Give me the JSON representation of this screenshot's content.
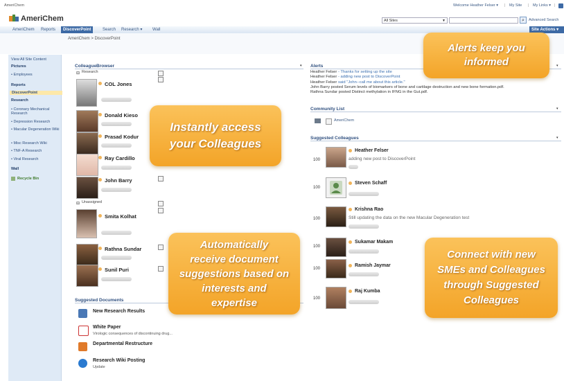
{
  "site": {
    "name": "AmeriChem",
    "top_label": "AmeriChem"
  },
  "topbar": {
    "welcome": "Welcome Heather Felser ▾",
    "my_site": "My Site",
    "my_links": "My Links ▾",
    "sep": "|"
  },
  "search": {
    "scope": "All Sites",
    "advanced": "Advanced Search",
    "actions": "Site Actions ▾"
  },
  "nav": {
    "tabs": [
      "AmeriChem",
      "Reports",
      "DiscoverPoint",
      "Search",
      "Research ▾",
      "Wall"
    ]
  },
  "breadcrumb": "AmeriChem > DiscoverPoint",
  "sidebar": {
    "view_all": "View All Site Content",
    "pictures": "Pictures",
    "employees": "• Employees",
    "reports": "Reports",
    "discoverpoint": "DiscoverPoint",
    "research": "Research",
    "research_items": [
      "• Coronary Mechanical Research",
      "• Depression Research",
      "• Macular Degeneration Wiki",
      "• Misc Research Wiki",
      "• TNF-A Research",
      "• Viral Research"
    ],
    "wall": "Wall",
    "recycle": "Recycle Bin"
  },
  "colleague_browser": {
    "title": "ColleagueBrowser",
    "group_research": "Research",
    "group_unassigned": "Unassigned",
    "research": [
      "COL Jones",
      "Donald Kieso",
      "Prasad Kodur",
      "Ray Cardillo",
      "John Barry"
    ],
    "unassigned": [
      "Smita Kolhat",
      "Rathna Sundar",
      "Sunil Puri"
    ]
  },
  "alerts": {
    "title": "Alerts",
    "lines": [
      {
        "who": "Heather Felser",
        "what": " - Thanks for setting up the site"
      },
      {
        "who": "Heather Felser",
        "what": " - adding new post to DiscoverPoint"
      },
      {
        "who": "Heather Felser",
        "what": " said \"John--call me about this article.\""
      },
      {
        "who": "John Barry",
        "what": " posted Serum levels of biomarkers of bone and cartilage destruction and new bone formation.pdf."
      },
      {
        "who": "Rathna Sundar",
        "what": " posted Distinct methylation in IFNG in the Gut.pdf."
      }
    ]
  },
  "community": {
    "title": "Community List",
    "item": "AmeriChem"
  },
  "suggested_colleagues": {
    "title": "Suggested Colleagues",
    "items": [
      {
        "score": "100",
        "name": "Heather Felser",
        "note": "adding new post to DiscoverPoint"
      },
      {
        "score": "100",
        "name": "Steven Schaff",
        "note": ""
      },
      {
        "score": "100",
        "name": "Krishna Rao",
        "note": "Still updating the data on the new Macular Degeneration test"
      },
      {
        "score": "100",
        "name": "Sukamar Makam",
        "note": ""
      },
      {
        "score": "100",
        "name": "Ramish Jaymar",
        "note": ""
      },
      {
        "score": "100",
        "name": "Raj Kumba",
        "note": ""
      }
    ]
  },
  "suggested_documents": {
    "title": "Suggested Documents",
    "items": [
      {
        "title": "New Research Results",
        "sub": ""
      },
      {
        "title": "White Paper",
        "sub": "Virologic consequences of discontinuing drug..."
      },
      {
        "title": "Departmental Restructure",
        "sub": ""
      },
      {
        "title": "Research Wiki Posting",
        "sub": "Update"
      }
    ]
  },
  "callouts": {
    "alerts": [
      "Alerts keep you",
      "informed"
    ],
    "colleagues": [
      "Instantly access",
      "your Colleagues"
    ],
    "documents": [
      "Automatically",
      "receive document",
      "suggestions based on",
      "interests and",
      "expertise"
    ],
    "connect": [
      "Connect with new",
      "SMEs and Colleagues",
      "through Suggested",
      "Colleagues"
    ]
  },
  "colors": {
    "accent": "#3d6aa5",
    "callout": "#f3a428",
    "selected": "#fde8a8"
  }
}
